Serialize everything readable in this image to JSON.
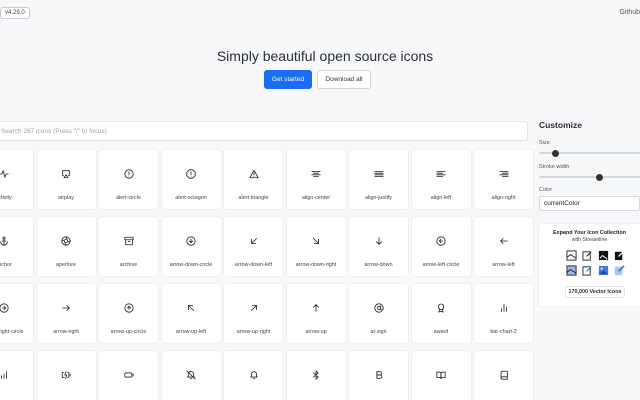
{
  "header": {
    "version": "v4.29.0",
    "github": "Github"
  },
  "hero": {
    "title": "Simply beautiful open source icons",
    "primary_button": "Get started",
    "secondary_button": "Download all"
  },
  "search": {
    "placeholder": "Search 287 icons (Press \"/\" to focus)"
  },
  "icons": [
    {
      "label": "activity",
      "icon": "activity-icon"
    },
    {
      "label": "airplay",
      "icon": "airplay-icon"
    },
    {
      "label": "alert-circle",
      "icon": "alert-circle-icon"
    },
    {
      "label": "alert-octagon",
      "icon": "alert-octagon-icon"
    },
    {
      "label": "alert-triangle",
      "icon": "alert-triangle-icon"
    },
    {
      "label": "align-center",
      "icon": "align-center-icon"
    },
    {
      "label": "align-justify",
      "icon": "align-justify-icon"
    },
    {
      "label": "align-left",
      "icon": "align-left-icon"
    },
    {
      "label": "align-right",
      "icon": "align-right-icon"
    },
    {
      "label": "anchor",
      "icon": "anchor-icon"
    },
    {
      "label": "aperture",
      "icon": "aperture-icon"
    },
    {
      "label": "archive",
      "icon": "archive-icon"
    },
    {
      "label": "arrow-down-circle",
      "icon": "arrow-down-circle-icon"
    },
    {
      "label": "arrow-down-left",
      "icon": "arrow-down-left-icon"
    },
    {
      "label": "arrow-down-right",
      "icon": "arrow-down-right-icon"
    },
    {
      "label": "arrow-down",
      "icon": "arrow-down-icon"
    },
    {
      "label": "arrow-left-circle",
      "icon": "arrow-left-circle-icon"
    },
    {
      "label": "arrow-left",
      "icon": "arrow-left-icon"
    },
    {
      "label": "arrow-right-circle",
      "icon": "arrow-right-circle-icon"
    },
    {
      "label": "arrow-right",
      "icon": "arrow-right-icon"
    },
    {
      "label": "arrow-up-circle",
      "icon": "arrow-up-circle-icon"
    },
    {
      "label": "arrow-up-left",
      "icon": "arrow-up-left-icon"
    },
    {
      "label": "arrow-up-right",
      "icon": "arrow-up-right-icon"
    },
    {
      "label": "arrow-up",
      "icon": "arrow-up-icon"
    },
    {
      "label": "at-sign",
      "icon": "at-sign-icon"
    },
    {
      "label": "award",
      "icon": "award-icon"
    },
    {
      "label": "bar-chart-2",
      "icon": "bar-chart-2-icon"
    },
    {
      "label": "",
      "icon": "bar-chart-icon"
    },
    {
      "label": "",
      "icon": "battery-charging-icon"
    },
    {
      "label": "",
      "icon": "battery-icon"
    },
    {
      "label": "",
      "icon": "bell-off-icon"
    },
    {
      "label": "",
      "icon": "bell-icon"
    },
    {
      "label": "",
      "icon": "bluetooth-icon"
    },
    {
      "label": "",
      "icon": "bold-icon"
    },
    {
      "label": "",
      "icon": "book-open-icon"
    },
    {
      "label": "",
      "icon": "book-icon"
    }
  ],
  "sidebar": {
    "title": "Customize",
    "size_label": "Size",
    "size_value": 0.16,
    "stroke_label": "Stroke width",
    "stroke_value": 0.6,
    "color_label": "Color",
    "color_value": "currentColor"
  },
  "promo": {
    "title": "Expand Your Icon Collection",
    "subtitle": "with Streamline",
    "button": "170,000 Vector Icons"
  },
  "colors": {
    "primary": "#1b6ef3",
    "background": "#f7f8fa"
  }
}
